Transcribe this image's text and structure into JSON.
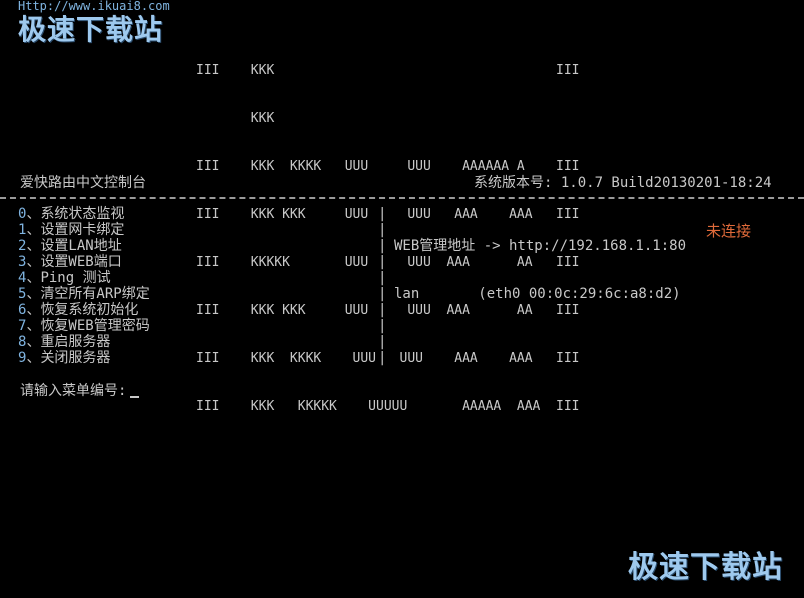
{
  "watermark": {
    "url": "Http://www.ikuai8.com",
    "logo_top": "极速下载站",
    "logo_bottom": "极速下载站"
  },
  "banner": {
    "lines": [
      "III    KKK                                    III",
      "       KKK",
      "III    KKK  KKKK   UUU     UUU    AAAAAA A    III",
      "III    KKK KKK     UUU     UUU   AAA    AAA   III",
      "III    KKKKK       UUU     UUU  AAA      AA   III",
      "III    KKK KKK     UUU     UUU  AAA      AA   III",
      "III    KKK  KKKK    UUU   UUU    AAA    AAA   III",
      "III    KKK   KKKKK    UUUUU       AAAAA  AAA  III"
    ]
  },
  "header": {
    "console_title": "爱快路由中文控制台",
    "version": "系统版本号: 1.0.7 Build20130201-18:24"
  },
  "menu": [
    {
      "num": "0",
      "label": "系统状态监视"
    },
    {
      "num": "1",
      "label": "设置网卡绑定"
    },
    {
      "num": "2",
      "label": "设置LAN地址"
    },
    {
      "num": "3",
      "label": "设置WEB端口"
    },
    {
      "num": "4",
      "label": "Ping 测试"
    },
    {
      "num": "5",
      "label": "清空所有ARP绑定"
    },
    {
      "num": "6",
      "label": "恢复系统初始化"
    },
    {
      "num": "7",
      "label": "恢复WEB管理密码"
    },
    {
      "num": "8",
      "label": "重启服务器"
    },
    {
      "num": "9",
      "label": "关闭服务器"
    }
  ],
  "menu_separator": "、",
  "column_bar": "|",
  "info": {
    "web_address": "WEB管理地址 -> http://192.168.1.1:80",
    "lan": "lan       (eth0 00:0c:29:6c:a8:d2)",
    "lan_status": "未连接"
  },
  "prompt": {
    "label": "请输入菜单编号:",
    "value": ""
  },
  "colors": {
    "background": "#000000",
    "text": "#c8c8c8",
    "menu_number": "#7fb3df",
    "status_disconnected": "#e06a3a",
    "watermark": "#9ec9ee"
  }
}
